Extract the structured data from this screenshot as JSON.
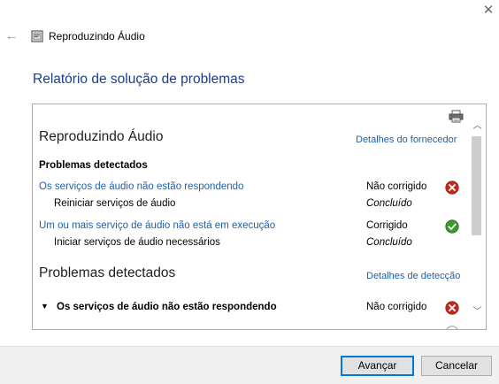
{
  "window": {
    "title": "Reproduzindo Áudio",
    "close_glyph": "✕",
    "back_glyph": "←"
  },
  "page": {
    "heading": "Relatório de solução de problemas"
  },
  "report": {
    "section1": {
      "title": "Reproduzindo Áudio",
      "publisher_link": "Detalhes do fornecedor",
      "sub_heading": "Problemas detectados",
      "issues": [
        {
          "title": "Os serviços de áudio não estão respondendo",
          "status": "Não corrigido",
          "status_icon": "error-icon",
          "action": "Reiniciar serviços de áudio",
          "action_status": "Concluído"
        },
        {
          "title": "Um ou mais serviço de áudio não está em execução",
          "status": "Corrigido",
          "status_icon": "check-icon",
          "action": "Iniciar serviços de áudio necessários",
          "action_status": "Concluído"
        }
      ]
    },
    "section2": {
      "title": "Problemas detectados",
      "detail_link": "Detalhes de detecção",
      "issue": {
        "title": "Os serviços de áudio não estão respondendo",
        "status": "Não corrigido",
        "status_icon": "error-icon"
      }
    }
  },
  "buttons": {
    "next": "Avançar",
    "cancel": "Cancelar"
  },
  "colors": {
    "link": "#1f5fa8",
    "heading": "#1a3d8f",
    "error": "#c42b1c",
    "success": "#3a9a2a"
  }
}
